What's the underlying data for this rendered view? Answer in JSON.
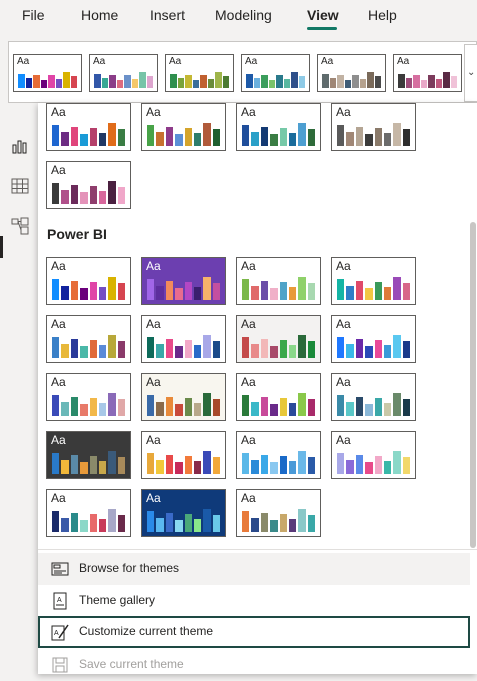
{
  "menu": {
    "items": [
      "File",
      "Home",
      "Insert",
      "Modeling",
      "View",
      "Help"
    ],
    "active": "View"
  },
  "ribbon_themes": [
    {
      "colors": [
        "#118dff",
        "#12239e",
        "#e66c37",
        "#6b007b",
        "#e044a7",
        "#744ec2",
        "#d9b300",
        "#d64550"
      ]
    },
    {
      "colors": [
        "#3257a8",
        "#37a794",
        "#8b3d88",
        "#dd6b7f",
        "#6b91c9",
        "#f5c869",
        "#77c4a8",
        "#dea6cf"
      ]
    },
    {
      "colors": [
        "#2f8f4e",
        "#7aa33b",
        "#c4b834",
        "#3a6f9a",
        "#c06030",
        "#6a8c3a",
        "#9fb54a",
        "#4b7b32"
      ]
    },
    {
      "colors": [
        "#1e5aa8",
        "#6ab0de",
        "#3c9e5c",
        "#7ac36a",
        "#2b7a8c",
        "#58b8a0",
        "#2e4f8a",
        "#8ecae6"
      ]
    },
    {
      "colors": [
        "#5f6b6d",
        "#a08776",
        "#c1b2a3",
        "#3e5c76",
        "#8e8e8e",
        "#b6a28e",
        "#7a6a5a",
        "#4a4a4a"
      ]
    },
    {
      "colors": [
        "#3b3b3b",
        "#9e4c7a",
        "#d66fa0",
        "#e9a8c8",
        "#7c3b5c",
        "#c0587e",
        "#5a2a44",
        "#f0c2d8"
      ]
    }
  ],
  "theme_rows_top": [
    [
      {
        "colors": [
          "#1e66d0",
          "#6d2c83",
          "#e0457b",
          "#1a9bd7",
          "#b5406b",
          "#203864",
          "#e06c1a",
          "#3a7d44"
        ]
      },
      {
        "colors": [
          "#48a348",
          "#c7702f",
          "#8e3b8a",
          "#5b8fd6",
          "#d4a42c",
          "#2e7d6b",
          "#b05a3a",
          "#1f5f2f"
        ]
      },
      {
        "colors": [
          "#1f4e9b",
          "#2aa0c8",
          "#143a73",
          "#3a7d44",
          "#76c9a8",
          "#1a6c9c",
          "#4d9fd1",
          "#2e6b3a"
        ]
      },
      {
        "colors": [
          "#5a5a5a",
          "#a08776",
          "#b4a594",
          "#3b3b3b",
          "#8a7a6a",
          "#6b6b6b",
          "#c6b7a6",
          "#2e2e2e"
        ]
      }
    ],
    [
      {
        "colors": [
          "#3a3a3a",
          "#b0508a",
          "#6b2a5a",
          "#e493b9",
          "#8f3e6d",
          "#d8679c",
          "#4a2040",
          "#f0a7c9"
        ]
      }
    ]
  ],
  "power_bi_title": "Power BI",
  "power_bi_tiles": [
    {
      "bg": "#ffffff",
      "aa": "#252423",
      "colors": [
        "#118dff",
        "#12239e",
        "#e66c37",
        "#6b007b",
        "#e044a7",
        "#744ec2",
        "#d9b300",
        "#d64550"
      ]
    },
    {
      "bg": "#6c3fb0",
      "aa": "#ffffff",
      "colors": [
        "#a066e8",
        "#5d2e9e",
        "#f28a5c",
        "#e86b8f",
        "#b347c4",
        "#3a1f6e",
        "#f7b26a",
        "#c44fa0"
      ]
    },
    {
      "bg": "#ffffff",
      "aa": "#252423",
      "colors": [
        "#7cb84a",
        "#e06a6a",
        "#6b4ea8",
        "#f0b0c8",
        "#4fa3c8",
        "#e89a3a",
        "#8fd16a",
        "#a8d8b0"
      ]
    },
    {
      "bg": "#ffffff",
      "aa": "#252423",
      "colors": [
        "#15b5a5",
        "#2f7ec7",
        "#e04a6a",
        "#f2c744",
        "#3a9a5a",
        "#e07a3a",
        "#9a4ab8",
        "#d8678a"
      ]
    },
    {
      "bg": "#ffffff",
      "aa": "#252423",
      "colors": [
        "#3a80c8",
        "#e8b83a",
        "#2a3a9a",
        "#4ab8a8",
        "#e06a3a",
        "#5a8ad8",
        "#b8a83a",
        "#8a3a6a"
      ]
    },
    {
      "bg": "#ffffff",
      "aa": "#252423",
      "colors": [
        "#0e6b5a",
        "#3aa8a8",
        "#e84a8a",
        "#6a2a8a",
        "#f2a8c8",
        "#2a6ac8",
        "#a8a8e8",
        "#1a4a8a"
      ]
    },
    {
      "bg": "#f3f2f1",
      "aa": "#252423",
      "colors": [
        "#c44a4a",
        "#e88a8a",
        "#f2b8b8",
        "#a84a6a",
        "#3aa84a",
        "#8ad88a",
        "#2a6a3a",
        "#1a8a3a"
      ]
    },
    {
      "bg": "#ffffff",
      "aa": "#252423",
      "colors": [
        "#1f78ff",
        "#3ab8e8",
        "#6a2aa8",
        "#2a4ab8",
        "#e84a9a",
        "#3a9ad8",
        "#5ac8f0",
        "#1a3a8a"
      ]
    },
    {
      "bg": "#ffffff",
      "aa": "#252423",
      "colors": [
        "#3a4ab8",
        "#6ab8b8",
        "#2a8a6a",
        "#e87a6a",
        "#f2b84a",
        "#a8c8e8",
        "#8a6ab8",
        "#e0a8a8"
      ]
    },
    {
      "bg": "#f8f6ef",
      "aa": "#252423",
      "colors": [
        "#3a6aa8",
        "#8a6a4a",
        "#e88a3a",
        "#c84a3a",
        "#6a8a4a",
        "#b8a88a",
        "#2a6a3a",
        "#a84a2a"
      ]
    },
    {
      "bg": "#ffffff",
      "aa": "#252423",
      "colors": [
        "#2a7a3a",
        "#3ab8c8",
        "#c84a9a",
        "#6a2a8a",
        "#e8c83a",
        "#2a4a9a",
        "#8ac84a",
        "#a82a6a"
      ]
    },
    {
      "bg": "#ffffff",
      "aa": "#252423",
      "colors": [
        "#3a8aa8",
        "#5ac8c8",
        "#2a4a6a",
        "#8ab8d8",
        "#3aa8a8",
        "#c8c8a8",
        "#6a8a6a",
        "#1a3a4a"
      ]
    },
    {
      "bg": "#3a3a3a",
      "aa": "#ffffff",
      "colors": [
        "#2a7ac8",
        "#f2b83a",
        "#5a8aa8",
        "#e89a3a",
        "#8a8a6a",
        "#c8a84a",
        "#3a5a7a",
        "#a88a5a"
      ]
    },
    {
      "bg": "#ffffff",
      "aa": "#252423",
      "colors": [
        "#e8a83a",
        "#f2c83a",
        "#e84a4a",
        "#c82a5a",
        "#f27a3a",
        "#8a2a4a",
        "#3a4ab8",
        "#f2a83a"
      ]
    },
    {
      "bg": "#ffffff",
      "aa": "#252423",
      "colors": [
        "#5ab8e8",
        "#2a8ad8",
        "#3aa8e8",
        "#8ac8f0",
        "#1a6ac8",
        "#4a9ad8",
        "#6ab8e8",
        "#2a5aa8"
      ]
    },
    {
      "bg": "#ffffff",
      "aa": "#252423",
      "colors": [
        "#a8a8e8",
        "#8a6ad8",
        "#5a8ae8",
        "#e84a8a",
        "#f2a8c8",
        "#3ab8a8",
        "#8ad8c8",
        "#f2d86a"
      ]
    },
    {
      "bg": "#ffffff",
      "aa": "#252423",
      "colors": [
        "#1a2a6a",
        "#3a5aa8",
        "#2a8a8a",
        "#8ad8c8",
        "#e86a6a",
        "#c83a5a",
        "#a8a8c8",
        "#6a2a4a"
      ]
    },
    {
      "bg": "#0f3a7a",
      "aa": "#ffffff",
      "colors": [
        "#2a8ae8",
        "#5ab8f0",
        "#3a6ac8",
        "#8ad8f0",
        "#4aa87a",
        "#8ae88a",
        "#1a5aa8",
        "#6ac8e8"
      ]
    },
    {
      "bg": "#ffffff",
      "aa": "#252423",
      "colors": [
        "#e87a3a",
        "#2a4a8a",
        "#8a8a6a",
        "#3a8a8a",
        "#c8a86a",
        "#5a3a7a",
        "#8ac8c8",
        "#3aa8a8"
      ]
    }
  ],
  "actions": [
    {
      "label": "Browse for themes",
      "icon": "browse-themes-icon",
      "state": "hover"
    },
    {
      "label": "Theme gallery",
      "icon": "theme-gallery-icon",
      "state": "normal"
    },
    {
      "label": "Customize current theme",
      "icon": "customize-theme-icon",
      "state": "focused"
    },
    {
      "label": "Save current theme",
      "icon": "save-theme-icon",
      "state": "disabled"
    }
  ],
  "tile_aa_label": "Aa",
  "left_rail": [
    "report-view-icon",
    "table-view-icon",
    "model-view-icon"
  ]
}
